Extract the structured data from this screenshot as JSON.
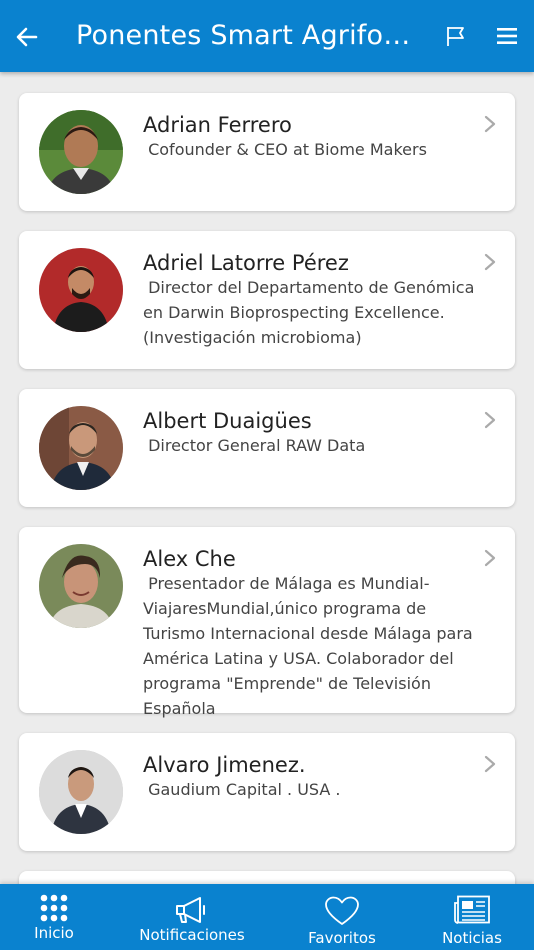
{
  "header": {
    "title": "Ponentes Smart Agrifood ...",
    "icons": [
      "back-arrow-icon",
      "flag-icon",
      "hamburger-menu-icon"
    ]
  },
  "speakers": [
    {
      "name": "Adrian Ferrero",
      "role": " Cofounder & CEO at Biome Makers"
    },
    {
      "name": "Adriel Latorre Pérez",
      "role": " Director del Departamento de Genómica en Darwin Bioprospecting Excellence. (Investigación microbioma)"
    },
    {
      "name": "Albert Duaigües",
      "role": " Director General RAW Data"
    },
    {
      "name": "Alex Che",
      "role": " Presentador de Málaga es Mundial-ViajaresMundial,único programa de Turismo Internacional desde Málaga para América Latina y USA. Colaborador del programa \"Emprende\" de Televisión Española"
    },
    {
      "name": "Alvaro Jimenez.",
      "role": " Gaudium Capital . USA ."
    }
  ],
  "bottom_nav": [
    {
      "label": "Inicio",
      "icon": "grid-icon"
    },
    {
      "label": "Notificaciones",
      "icon": "megaphone-icon"
    },
    {
      "label": "Favoritos",
      "icon": "heart-icon"
    },
    {
      "label": "Noticias",
      "icon": "newspaper-icon"
    }
  ],
  "colors": {
    "primary": "#0a82cf",
    "background": "#ececec",
    "card": "#ffffff"
  }
}
